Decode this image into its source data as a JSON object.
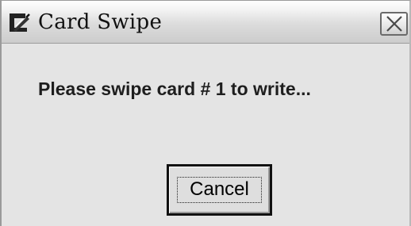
{
  "window": {
    "title": "Card Swipe",
    "app_icon": "card-swipe-app-icon",
    "close_icon": "close-icon"
  },
  "dialog": {
    "message": "Please swipe card # 1 to write..."
  },
  "buttons": {
    "cancel_label": "Cancel"
  },
  "colors": {
    "window_background": "#e4e4e4",
    "text": "#1e1e1e",
    "button_border": "#111111"
  }
}
